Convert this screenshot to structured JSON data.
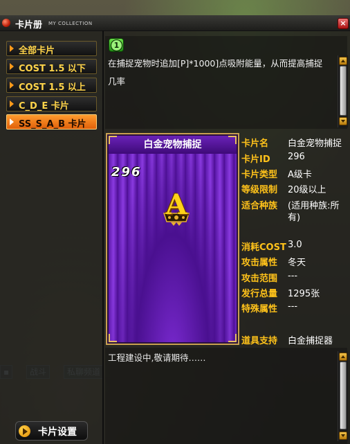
{
  "window": {
    "title": "卡片册",
    "subtitle": "MY COLLECTION",
    "close_label": "×"
  },
  "menu": {
    "items": [
      {
        "label": "全部卡片",
        "active": false
      },
      {
        "label": "COST 1.5 以下",
        "active": false
      },
      {
        "label": "COST 1.5 以上",
        "active": false
      },
      {
        "label": "C_D_E 卡片",
        "active": false
      },
      {
        "label": "SS_S_A_B 卡片",
        "active": true
      }
    ]
  },
  "description": {
    "badge_number": "1",
    "text_line1": "在捕捉宠物时追加[P]*1000]点吸附能量，从而提高捕捉",
    "text_line2": "几率"
  },
  "card": {
    "name": "白金宠物捕捉",
    "number": "296",
    "rank": "A"
  },
  "info": {
    "name_label": "卡片名",
    "name_value": "白金宠物捕捉",
    "id_label": "卡片ID",
    "id_value": "296",
    "type_label": "卡片类型",
    "type_value": "A级卡",
    "level_label": "等级限制",
    "level_value": "20级以上",
    "race_label": "适合种族",
    "race_value_line1": "(适用种族:所",
    "race_value_line2": "有)",
    "cost_label": "消耗COST",
    "cost_value": "3.0",
    "attr_label": "攻击属性",
    "attr_value": "冬天",
    "range_label": "攻击范围",
    "range_value": "---",
    "issue_label": "发行总量",
    "issue_value": "1295张",
    "special_label": "特殊属性",
    "special_value": "---",
    "item_label": "道具支持",
    "item_value": "白金捕捉器"
  },
  "bottom_panel": {
    "text": "工程建设中,敬请期待……"
  },
  "settings_button": {
    "label": "卡片设置"
  },
  "colors": {
    "accent": "#ff9b2e",
    "label_gold": "#ffc21a",
    "menu_text": "#ffd44a"
  }
}
